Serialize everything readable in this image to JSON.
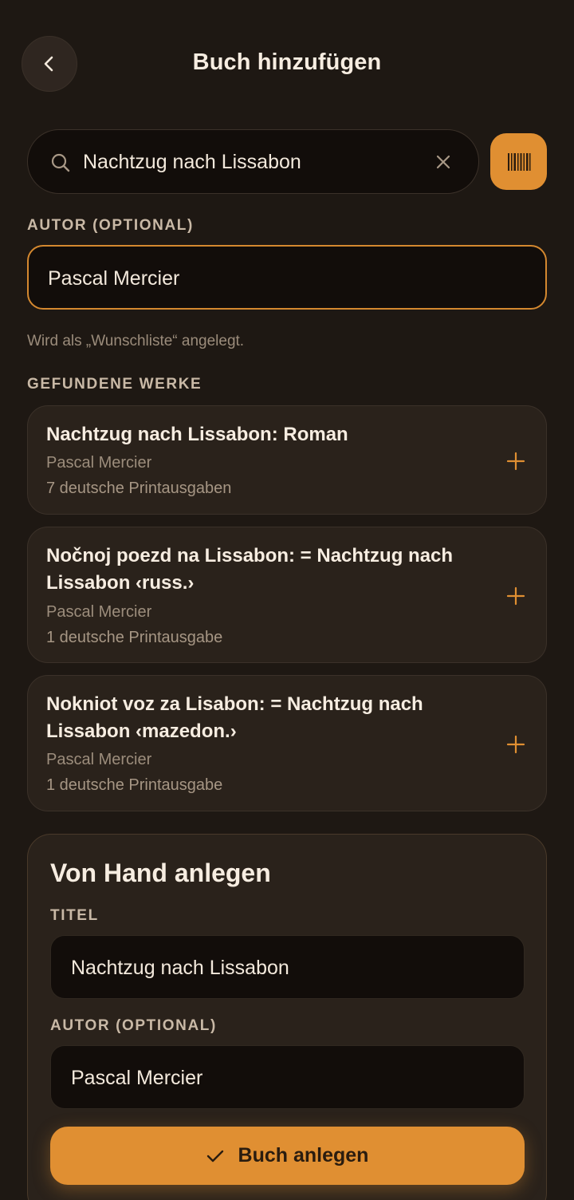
{
  "header": {
    "back_icon": "chevron-left-icon",
    "title": "Buch hinzufügen"
  },
  "search": {
    "value": "Nachtzug nach Lissabon",
    "search_icon": "search-icon",
    "clear_icon": "close-icon",
    "barcode_icon": "barcode-icon"
  },
  "author": {
    "label": "AUTOR (OPTIONAL)",
    "value": "Pascal Mercier",
    "hint": "Wird als „Wunschliste“ angelegt."
  },
  "results": {
    "label": "GEFUNDENE WERKE",
    "items": [
      {
        "title": "Nachtzug nach Lissabon: Roman",
        "author": "Pascal Mercier",
        "editions": "7 deutsche Printausgaben"
      },
      {
        "title": "Nočnoj poezd na Lissabon: = Nachtzug nach Lissabon ‹russ.›",
        "author": "Pascal Mercier",
        "editions": "1 deutsche Printausgabe"
      },
      {
        "title": "Nokniot voz za Lisabon: = Nachtzug nach Lissabon ‹mazedon.›",
        "author": "Pascal Mercier",
        "editions": "1 deutsche Printausgabe"
      }
    ]
  },
  "manual": {
    "heading": "Von Hand anlegen",
    "title_label": "TITEL",
    "title_value": "Nachtzug nach Lissabon",
    "author_label": "AUTOR (OPTIONAL)",
    "author_value": "Pascal Mercier",
    "submit_label": "Buch anlegen",
    "submit_icon": "check-icon"
  },
  "colors": {
    "background": "#1e1813",
    "accent": "#e08f32",
    "card": "#2a221b",
    "field": "#120d0a"
  }
}
